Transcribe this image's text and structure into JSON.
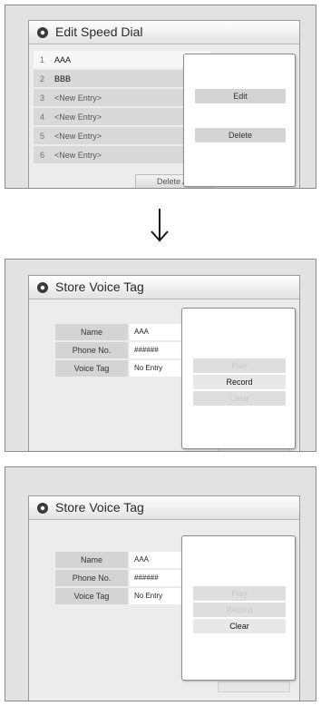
{
  "top": {
    "title": "Edit Speed Dial",
    "entries": [
      {
        "num": "1",
        "name": "AAA"
      },
      {
        "num": "2",
        "name": "BBB"
      },
      {
        "num": "3",
        "name": "<New Entry>"
      },
      {
        "num": "4",
        "name": "<New Entry>"
      },
      {
        "num": "5",
        "name": "<New Entry>"
      },
      {
        "num": "6",
        "name": "<New Entry>"
      }
    ],
    "menu": {
      "edit": "Edit",
      "delete": "Delete"
    },
    "delete_all": "Delete All"
  },
  "middle": {
    "title": "Store Voice Tag",
    "fields": {
      "name_label": "Name",
      "name_value": "AAA",
      "phone_label": "Phone No.",
      "phone_value": "######",
      "voice_label": "Voice Tag",
      "voice_value": "No Entry"
    },
    "menu": {
      "play": "Play",
      "record": "Record",
      "clear": "Clear"
    }
  },
  "bottom": {
    "title": "Store Voice Tag",
    "fields": {
      "name_label": "Name",
      "name_value": "AAA",
      "phone_label": "Phone No.",
      "phone_value": "######",
      "voice_label": "Voice Tag",
      "voice_value": "No Entry"
    },
    "menu": {
      "play": "Play",
      "record": "Record",
      "clear": "Clear"
    }
  },
  "arrow_icon": "down-arrow-icon"
}
